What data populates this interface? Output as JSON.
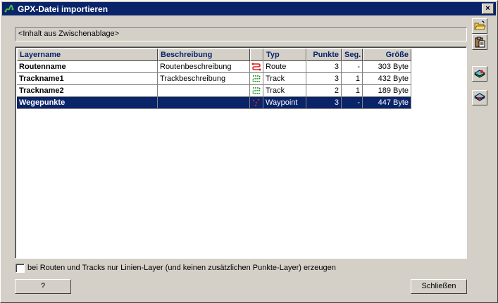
{
  "window": {
    "title": "GPX-Datei importieren",
    "close_label": "×"
  },
  "source": {
    "text": "<Inhalt aus Zwischenablage>"
  },
  "table": {
    "columns": [
      "Layername",
      "Beschreibung",
      "",
      "Typ",
      "Punkte",
      "Seg.",
      "Größe"
    ],
    "rows": [
      {
        "layername": "Routenname",
        "beschreibung": "Routenbeschreibung",
        "icon": "route-icon",
        "typ": "Route",
        "punkte": "3",
        "seg": "-",
        "groesse": "303 Byte",
        "selected": false
      },
      {
        "layername": "Trackname1",
        "beschreibung": "Trackbeschreibung",
        "icon": "track-icon",
        "typ": "Track",
        "punkte": "3",
        "seg": "1",
        "groesse": "432 Byte",
        "selected": false
      },
      {
        "layername": "Trackname2",
        "beschreibung": "",
        "icon": "track-icon",
        "typ": "Track",
        "punkte": "2",
        "seg": "1",
        "groesse": "189 Byte",
        "selected": false
      },
      {
        "layername": "Wegepunkte",
        "beschreibung": "",
        "icon": "waypoint-icon",
        "typ": "Waypoint",
        "punkte": "3",
        "seg": "-",
        "groesse": "447 Byte",
        "selected": true
      }
    ]
  },
  "options": {
    "lines_only_label": "bei Routen und Tracks nur Linien-Layer (und keinen zusätzlichen Punkte-Layer) erzeugen",
    "lines_only_checked": false
  },
  "buttons": {
    "help_label": "?",
    "close_label": "Schließen"
  },
  "colors": {
    "title_bar": "#0a246a",
    "route_icon": "#e02020",
    "track_icon": "#1a8a1a",
    "waypoint_icon": "#c02020"
  }
}
